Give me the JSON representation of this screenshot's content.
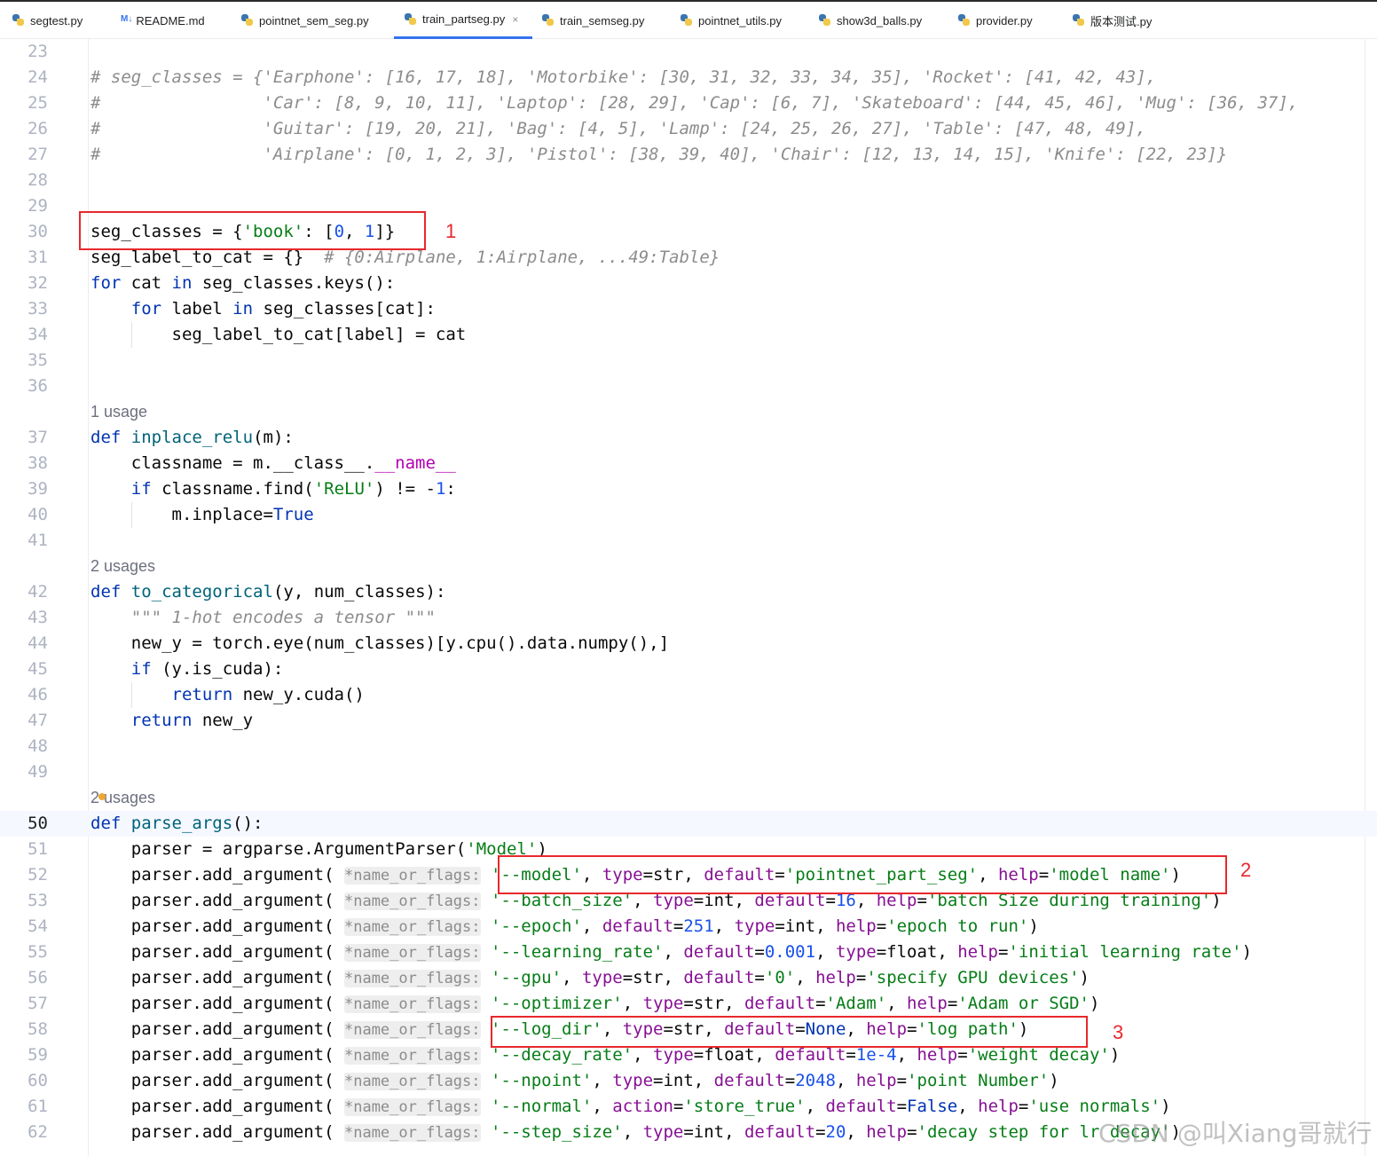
{
  "tabs": [
    {
      "label": "segtest.py",
      "icon": "python-file-icon",
      "active": false
    },
    {
      "label": "README.md",
      "icon": "markdown-file-icon",
      "active": false
    },
    {
      "label": "pointnet_sem_seg.py",
      "icon": "python-file-icon",
      "active": false
    },
    {
      "label": "train_partseg.py",
      "icon": "python-file-icon",
      "active": true,
      "close": "×"
    },
    {
      "label": "train_semseg.py",
      "icon": "python-file-icon",
      "active": false
    },
    {
      "label": "pointnet_utils.py",
      "icon": "python-file-icon",
      "active": false
    },
    {
      "label": "show3d_balls.py",
      "icon": "python-file-icon",
      "active": false
    },
    {
      "label": "provider.py",
      "icon": "python-file-icon",
      "active": false
    },
    {
      "label": "版本测试.py",
      "icon": "python-file-icon",
      "active": false
    }
  ],
  "md_icon_text": "M↓",
  "hints": {
    "name_or_flags": "*name_or_flags:"
  },
  "usages": {
    "u37": "1 usage",
    "u42": "2 usages",
    "u50": "2 usages"
  },
  "line_numbers": [
    "23",
    "24",
    "25",
    "26",
    "27",
    "28",
    "29",
    "30",
    "31",
    "32",
    "33",
    "34",
    "35",
    "36",
    "37",
    "38",
    "39",
    "40",
    "41",
    "42",
    "43",
    "44",
    "45",
    "46",
    "47",
    "48",
    "49",
    "50",
    "51",
    "52",
    "53",
    "54",
    "55",
    "56",
    "57",
    "58",
    "59",
    "60",
    "61",
    "62"
  ],
  "annotations": {
    "box1": "1",
    "box2": "2",
    "box3": "3"
  },
  "watermark": "CSDN @叫Xiang哥就行",
  "code": {
    "l24": "# seg_classes = {'Earphone': [16, 17, 18], 'Motorbike': [30, 31, 32, 33, 34, 35], 'Rocket': [41, 42, 43],",
    "l25": "#                'Car': [8, 9, 10, 11], 'Laptop': [28, 29], 'Cap': [6, 7], 'Skateboard': [44, 45, 46], 'Mug': [36, 37],",
    "l26": "#                'Guitar': [19, 20, 21], 'Bag': [4, 5], 'Lamp': [24, 25, 26, 27], 'Table': [47, 48, 49],",
    "l27": "#                'Airplane': [0, 1, 2, 3], 'Pistol': [38, 39, 40], 'Chair': [12, 13, 14, 15], 'Knife': [22, 23]}",
    "l31_comment": "# {0:Airplane, 1:Airplane, ...49:Table}",
    "l43": "\"\"\" 1-hot encodes a tensor \"\"\""
  },
  "colors": {
    "keyword": "#0033b3",
    "string": "#067d17",
    "number": "#1750eb",
    "comment": "#8c8c8c",
    "function": "#00627a",
    "param": "#871094",
    "annotation_red": "#e8282c",
    "active_tab": "#3574f0"
  }
}
